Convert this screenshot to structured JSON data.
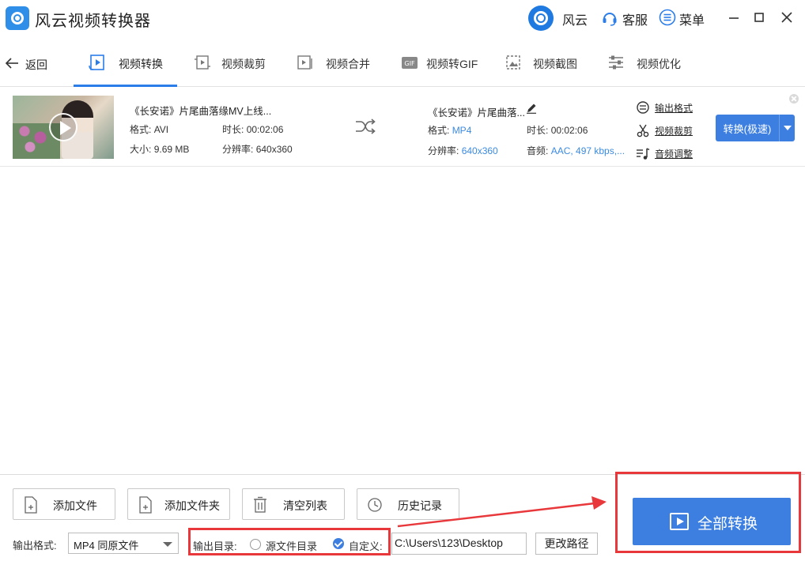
{
  "app": {
    "title": "风云视频转换器",
    "brand_label": "风云",
    "service_label": "客服",
    "menu_label": "菜单"
  },
  "nav": {
    "back_label": "返回",
    "tabs": [
      {
        "label": "视频转换",
        "icon": "video-convert-icon",
        "active": true
      },
      {
        "label": "视频裁剪",
        "icon": "video-crop-icon"
      },
      {
        "label": "视频合并",
        "icon": "video-merge-icon"
      },
      {
        "label": "视频转GIF",
        "icon": "gif-icon"
      },
      {
        "label": "视频截图",
        "icon": "screenshot-icon"
      },
      {
        "label": "视频优化",
        "icon": "optimize-icon"
      }
    ]
  },
  "file": {
    "title": "《长安诺》片尾曲落缘MV上线...",
    "src": {
      "format_label": "格式:",
      "format": "AVI",
      "duration_label": "时长:",
      "duration": "00:02:06",
      "size_label": "大小:",
      "size": "9.69 MB",
      "resolution_label": "分辨率:",
      "resolution": "640x360"
    },
    "out": {
      "title": "《长安诺》片尾曲落...",
      "format_label": "格式:",
      "format": "MP4",
      "duration_label": "时长:",
      "duration": "00:02:06",
      "resolution_label": "分辨率:",
      "resolution": "640x360",
      "audio_label": "音频:",
      "audio": "AAC, 497 kbps,..."
    },
    "links": {
      "output_format": "输出格式",
      "video_crop": "视频裁剪",
      "audio_adjust": "音频调整"
    },
    "convert_button": "转换(极速)"
  },
  "toolbar": {
    "add_file": "添加文件",
    "add_folder": "添加文件夹",
    "clear_list": "清空列表",
    "history": "历史记录"
  },
  "output": {
    "format_label": "输出格式:",
    "format_value": "MP4 同原文件",
    "dir_label": "输出目录:",
    "source_dir_option": "源文件目录",
    "custom_option": "自定义:",
    "source_dir_selected": false,
    "custom_selected": true,
    "path": "C:\\Users\\123\\Desktop",
    "change_path": "更改路径"
  },
  "convert_all": "全部转换",
  "colors": {
    "accent": "#3d7fe1",
    "highlight": "#e8383b"
  }
}
